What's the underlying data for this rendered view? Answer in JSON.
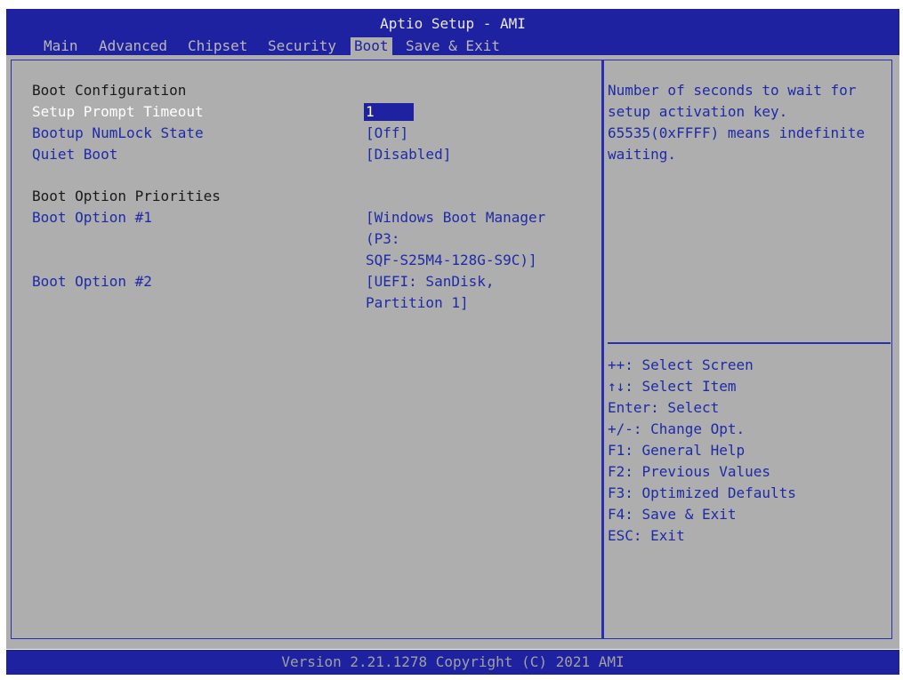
{
  "header": {
    "title": "Aptio Setup - AMI",
    "tabs": [
      "Main",
      "Advanced",
      "Chipset",
      "Security",
      "Boot",
      "Save & Exit"
    ],
    "active_tab": "Boot"
  },
  "boot": {
    "section1": "Boot Configuration",
    "setup_prompt_timeout": {
      "label": "Setup Prompt Timeout",
      "value": "1"
    },
    "bootup_numlock_state": {
      "label": "Bootup NumLock State",
      "value": "[Off]"
    },
    "quiet_boot": {
      "label": "Quiet Boot",
      "value": "[Disabled]"
    },
    "section2": "Boot Option Priorities",
    "boot_option_1": {
      "label": "Boot Option #1",
      "value_lines": [
        "[Windows Boot Manager",
        "(P3:",
        "SQF-S25M4-128G-S9C)]"
      ]
    },
    "boot_option_2": {
      "label": "Boot Option #2",
      "value_lines": [
        "[UEFI: SanDisk,",
        "Partition 1]"
      ]
    }
  },
  "help": {
    "lines": [
      "Number of seconds to wait for",
      "setup activation key.",
      "65535(0xFFFF) means indefinite",
      "waiting."
    ]
  },
  "keys": [
    "++: Select Screen",
    "↑↓: Select Item",
    "Enter: Select",
    "+/-: Change Opt.",
    "F1: General Help",
    "F2: Previous Values",
    "F3: Optimized Defaults",
    "F4: Save & Exit",
    "ESC: Exit"
  ],
  "footer": {
    "version": "Version 2.21.1278 Copyright (C) 2021 AMI"
  },
  "colors": {
    "header_bg": "#1f22a0",
    "body_bg": "#aeaeae",
    "item_text": "#1e2aa8",
    "heading_text": "#1a1a1a"
  }
}
